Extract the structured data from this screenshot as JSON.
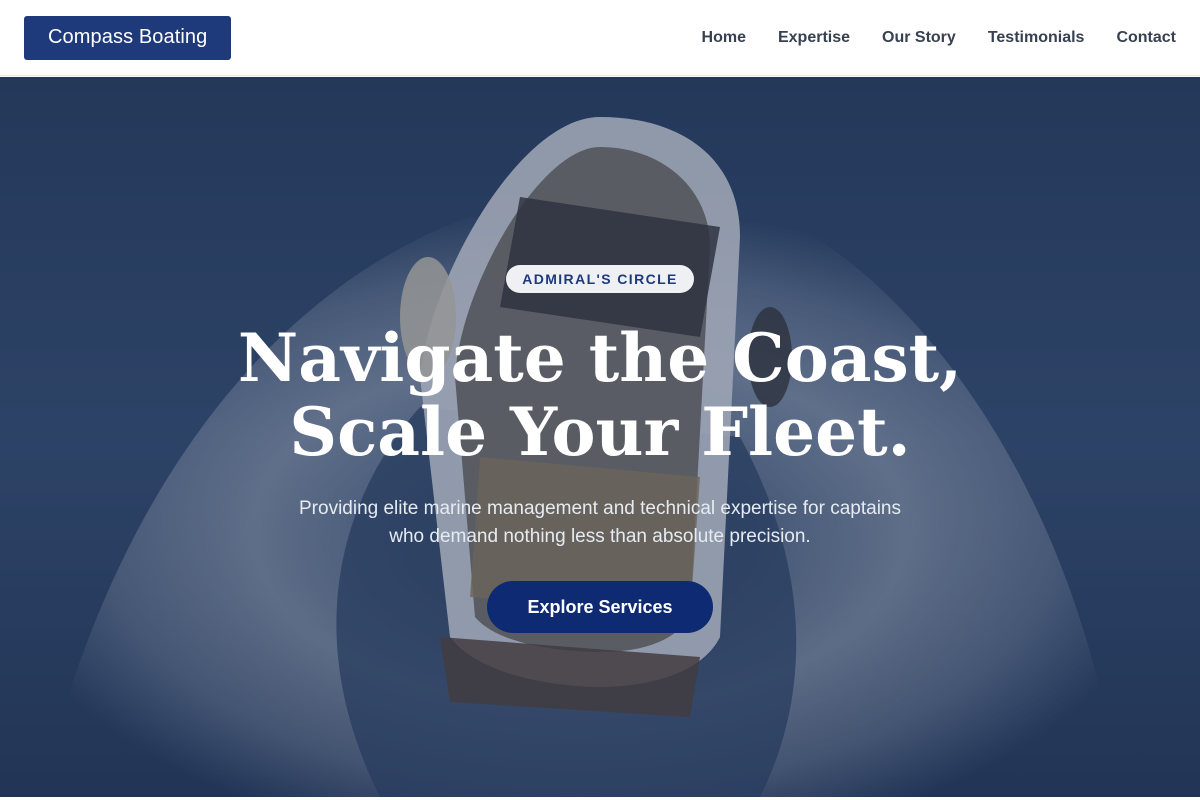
{
  "header": {
    "brand": "Compass Boating",
    "nav": [
      {
        "label": "Home"
      },
      {
        "label": "Expertise"
      },
      {
        "label": "Our Story"
      },
      {
        "label": "Testimonials"
      },
      {
        "label": "Contact"
      }
    ]
  },
  "hero": {
    "badge": "ADMIRAL'S CIRCLE",
    "headline": "Navigate the Coast, Scale Your Fleet.",
    "subtext": "Providing elite marine management and technical expertise for captains who demand nothing less than absolute precision.",
    "cta_label": "Explore Services",
    "background_image": "aerial-speedboat-on-sea"
  },
  "colors": {
    "brand_bg": "#1e3a7b",
    "cta_bg": "#0e2a73",
    "nav_text": "#374151",
    "badge_text": "#1e3a7b"
  }
}
